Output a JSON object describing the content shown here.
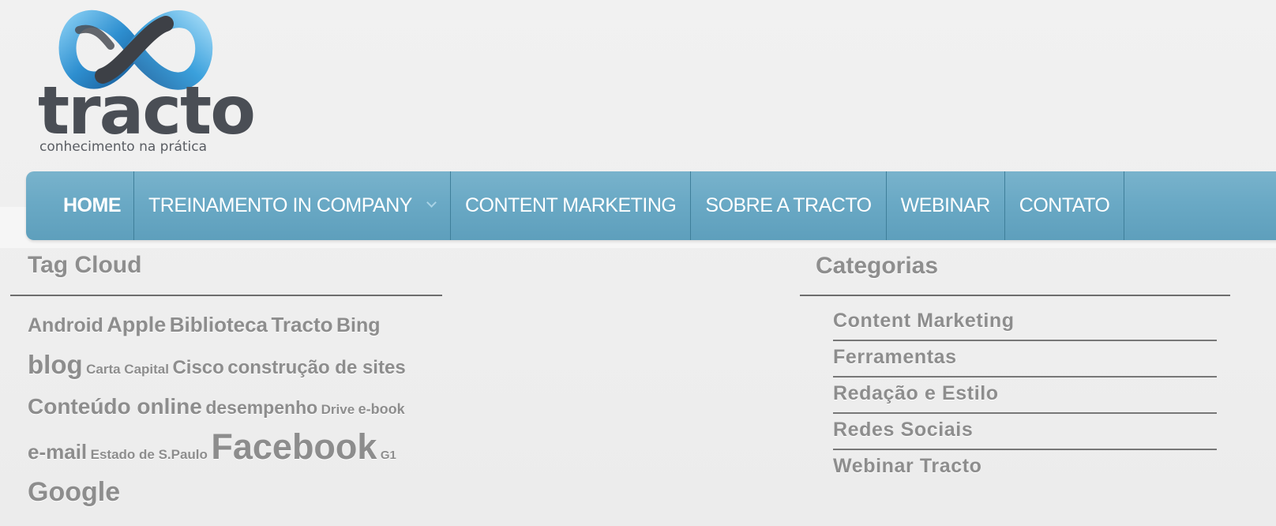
{
  "brand": {
    "wordmark": "tracto",
    "tagline": "conhecimento na prática"
  },
  "nav": {
    "items": [
      {
        "label": "HOME"
      },
      {
        "label": "TREINAMENTO IN COMPANY",
        "icon": "chevron-down-icon"
      },
      {
        "label": "CONTENT MARKETING"
      },
      {
        "label": "SOBRE A TRACTO"
      },
      {
        "label": "WEBINAR"
      },
      {
        "label": "CONTATO"
      }
    ]
  },
  "tag_cloud": {
    "title": "Tag Cloud",
    "tags": [
      {
        "label": "Android",
        "size": 25
      },
      {
        "label": "Apple",
        "size": 27
      },
      {
        "label": "Biblioteca",
        "size": 26
      },
      {
        "label": "Tracto",
        "size": 26
      },
      {
        "label": "Bing",
        "size": 25
      },
      {
        "label": "blog",
        "size": 33
      },
      {
        "label": "Carta Capital",
        "size": 17
      },
      {
        "label": "Cisco",
        "size": 24
      },
      {
        "label": "construção de sites",
        "size": 24
      },
      {
        "label": "Conteúdo online",
        "size": 28
      },
      {
        "label": "desempenho",
        "size": 23
      },
      {
        "label": "Drive",
        "size": 17
      },
      {
        "label": "e-book",
        "size": 18
      },
      {
        "label": "e-mail",
        "size": 26
      },
      {
        "label": "Estado de S.Paulo",
        "size": 17
      },
      {
        "label": "Facebook",
        "size": 45
      },
      {
        "label": "G1",
        "size": 15
      },
      {
        "label": "Google",
        "size": 34
      }
    ]
  },
  "categories": {
    "title": "Categorias",
    "items": [
      {
        "label": "Content Marketing"
      },
      {
        "label": "Ferramentas"
      },
      {
        "label": "Redação e Estilo"
      },
      {
        "label": "Redes Sociais"
      },
      {
        "label": "Webinar Tracto"
      }
    ]
  },
  "colors": {
    "nav_bg": "#6aa9c5",
    "text_muted": "#8d8d8d",
    "logo_blue": "#2e8fd0",
    "logo_dark": "#4a4e55"
  }
}
